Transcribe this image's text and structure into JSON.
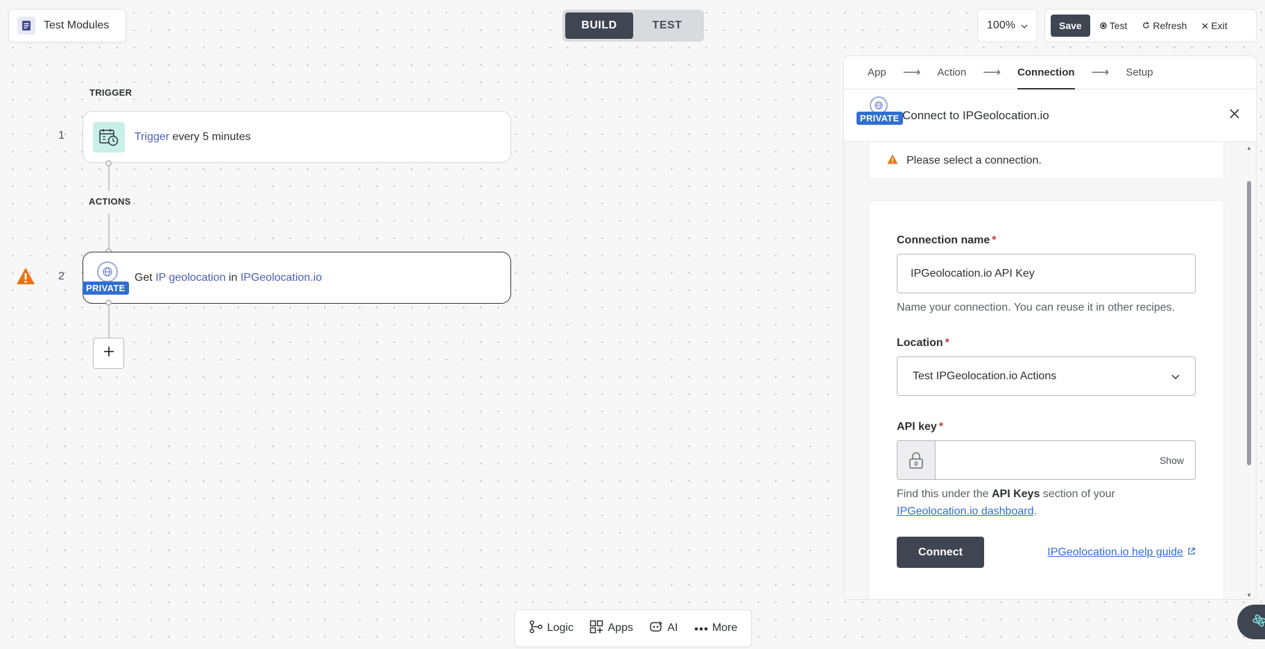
{
  "recipe": {
    "name": "Test Modules",
    "icon": "document-icon"
  },
  "mode_toggle": {
    "build": "BUILD",
    "test": "TEST",
    "active": "build"
  },
  "top_right": {
    "zoom": "100%",
    "save": "Save",
    "test": "Test",
    "refresh": "Refresh",
    "exit": "Exit"
  },
  "flow": {
    "trigger_label": "TRIGGER",
    "actions_label": "ACTIONS",
    "step1": {
      "number": "1",
      "link": "Trigger",
      "text": " every 5 minutes",
      "icon": "calendar-clock-icon"
    },
    "step2": {
      "number": "2",
      "prefix": "Get ",
      "link1": "IP geolocation",
      "mid": " in ",
      "link2": "IPGeolocation.io",
      "badge": "PRIVATE",
      "warning_icon": "warning-icon"
    }
  },
  "bottom_bar": {
    "logic": "Logic",
    "apps": "Apps",
    "ai": "AI",
    "more": "More"
  },
  "panel": {
    "wizard": [
      "App",
      "Action",
      "Connection",
      "Setup"
    ],
    "wizard_active": "Connection",
    "header_title": "Connect to IPGeolocation.io",
    "header_badge": "PRIVATE",
    "alert": "Please select a connection.",
    "form": {
      "connection_name_label": "Connection name",
      "connection_name_value": "IPGeolocation.io API Key",
      "connection_name_hint": "Name your connection. You can reuse it in other recipes.",
      "location_label": "Location",
      "location_value": "Test IPGeolocation.io Actions",
      "api_key_label": "API key",
      "api_key_show": "Show",
      "api_key_hint_1": "Find this under the ",
      "api_key_hint_bold": "API Keys",
      "api_key_hint_2": " section of your",
      "api_key_hint_link": "IPGeolocation.io dashboard",
      "api_key_hint_end": ".",
      "required_mark": "*",
      "connect": "Connect",
      "help_link": "IPGeolocation.io help guide"
    }
  },
  "colors": {
    "accent_dark": "#3f4652",
    "link": "#2f6fd1",
    "step_link": "#4c5fb3",
    "private_badge": "#2f6fd1",
    "warning": "#e8740f",
    "required": "#c23b3b"
  }
}
